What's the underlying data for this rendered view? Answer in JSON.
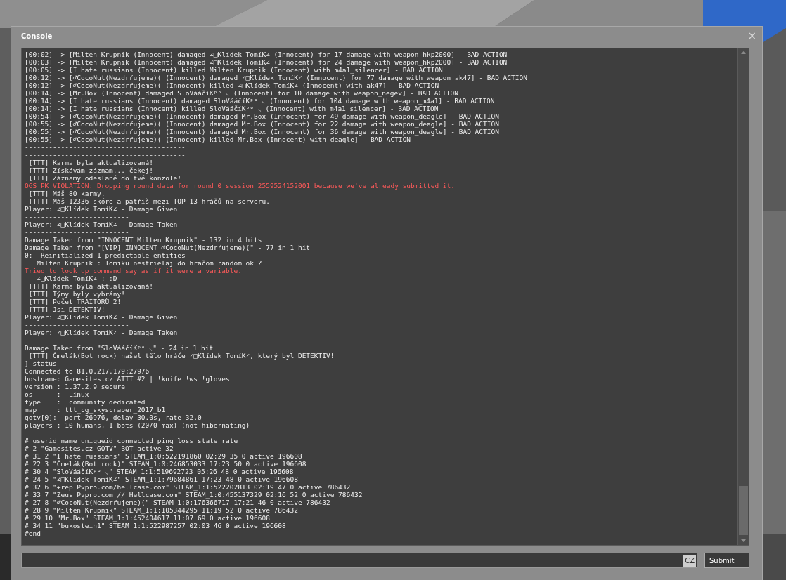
{
  "window": {
    "title": "Console",
    "close": "×"
  },
  "lines": [
    {
      "kind": "normal",
      "text": "[00:02] -> [Milten Krupnik (Innocent) damaged ∠□Klídek TomíK∠ (Innocent) for 17 damage with weapon_hkp2000] - BAD ACTION"
    },
    {
      "kind": "normal",
      "text": "[00:03] -> [Milten Krupnik (Innocent) damaged ∠□Klídek TomíK∠ (Innocent) for 24 damage with weapon_hkp2000] - BAD ACTION"
    },
    {
      "kind": "normal",
      "text": "[00:05] -> [I hate russians (Innocent) killed Milten Krupnik (Innocent) with m4a1_silencer] - BAD ACTION"
    },
    {
      "kind": "normal",
      "text": "[00:12] -> [♂CocoNut(Nezdrŕujeme)( (Innocent) damaged ∠□Klídek TomíK∠ (Innocent) for 77 damage with weapon_ak47] - BAD ACTION"
    },
    {
      "kind": "normal",
      "text": "[00:12] -> [♂CocoNut(Nezdrŕujeme)( (Innocent) killed ∠□Klídek TomíK∠ (Innocent) with ak47] - BAD ACTION"
    },
    {
      "kind": "normal",
      "text": "[00:14] -> [Mr.Box (Innocent) damaged SloVááčíKᵖᵒ ⸜ (Innocent) for 10 damage with weapon_negev] - BAD ACTION"
    },
    {
      "kind": "normal",
      "text": "[00:14] -> [I hate russians (Innocent) damaged SloVááčíKᵖᵒ ⸜ (Innocent) for 104 damage with weapon_m4a1] - BAD ACTION"
    },
    {
      "kind": "normal",
      "text": "[00:14] -> [I hate russians (Innocent) killed SloVááčíKᵖᵒ ⸜ (Innocent) with m4a1_silencer] - BAD ACTION"
    },
    {
      "kind": "normal",
      "text": "[00:54] -> [♂CocoNut(Nezdrŕujeme)( (Innocent) damaged Mr.Box (Innocent) for 49 damage with weapon_deagle] - BAD ACTION"
    },
    {
      "kind": "normal",
      "text": "[00:55] -> [♂CocoNut(Nezdrŕujeme)( (Innocent) damaged Mr.Box (Innocent) for 22 damage with weapon_deagle] - BAD ACTION"
    },
    {
      "kind": "normal",
      "text": "[00:55] -> [♂CocoNut(Nezdrŕujeme)( (Innocent) damaged Mr.Box (Innocent) for 36 damage with weapon_deagle] - BAD ACTION"
    },
    {
      "kind": "normal",
      "text": "[00:55] -> [♂CocoNut(Nezdrŕujeme)( (Innocent) killed Mr.Box (Innocent) with deagle] - BAD ACTION"
    },
    {
      "kind": "normal",
      "text": "----------------------------------------"
    },
    {
      "kind": "normal",
      "text": "----------------------------------------"
    },
    {
      "kind": "normal",
      "text": " [TTT] Karma byla aktualizovaná!"
    },
    {
      "kind": "normal",
      "text": " [TTT] Získávám záznam... čekej!"
    },
    {
      "kind": "normal",
      "text": " [TTT] Záznamy odeslané do tvé konzole!"
    },
    {
      "kind": "error",
      "text": "OGS PK VIOLATION: Dropping round data for round 0 session 2559524152001 because we've already submitted it."
    },
    {
      "kind": "normal",
      "text": " [TTT] Máš 80 karmy."
    },
    {
      "kind": "normal",
      "text": " [TTT] Máš 12336 skóre a patříš mezi TOP 13 hráčů na serveru."
    },
    {
      "kind": "normal",
      "text": "Player: ∠□Klídek TomíK∠ - Damage Given"
    },
    {
      "kind": "normal",
      "text": "--------------------------"
    },
    {
      "kind": "normal",
      "text": "Player: ∠□Klídek TomíK∠ - Damage Taken"
    },
    {
      "kind": "normal",
      "text": "--------------------------"
    },
    {
      "kind": "normal",
      "text": "Damage Taken from \"INNOCENT Milten Krupnik\" - 132 in 4 hits"
    },
    {
      "kind": "normal",
      "text": "Damage Taken from \"[VIP] INNOCENT ♂CocoNut(Nezdrŕujeme)(\" - 77 in 1 hit"
    },
    {
      "kind": "normal",
      "text": "0:  Reinitialized 1 predictable entities"
    },
    {
      "kind": "normal",
      "text": "   Milten Krupnik : Tomiku nestrielaj do hračom random ok ?"
    },
    {
      "kind": "error",
      "text": "Tried to look up command say as if it were a variable."
    },
    {
      "kind": "normal",
      "text": "   ∠□Klídek TomíK∠ : :D"
    },
    {
      "kind": "normal",
      "text": " [TTT] Karma byla aktualizovaná!"
    },
    {
      "kind": "normal",
      "text": " [TTT] Týmy byly vybrány!"
    },
    {
      "kind": "normal",
      "text": " [TTT] Počet TRAITORŮ 2!"
    },
    {
      "kind": "normal",
      "text": " [TTT] Jsi DETEKTIV!"
    },
    {
      "kind": "normal",
      "text": "Player: ∠□Klídek TomíK∠ - Damage Given"
    },
    {
      "kind": "normal",
      "text": "--------------------------"
    },
    {
      "kind": "normal",
      "text": "Player: ∠□Klídek TomíK∠ - Damage Taken"
    },
    {
      "kind": "normal",
      "text": "--------------------------"
    },
    {
      "kind": "normal",
      "text": "Damage Taken from \"SloVááčíKᵖᵒ ⸜\" - 24 in 1 hit"
    },
    {
      "kind": "normal",
      "text": " [TTT] Čmelák(Bot rock) našel tělo hráče ∠□Klídek TomíK∠, který byl DETEKTIV!"
    },
    {
      "kind": "normal",
      "text": "] status"
    },
    {
      "kind": "normal",
      "text": "Connected to 81.0.217.179:27976"
    },
    {
      "kind": "normal",
      "text": "hostname: Gamesites.cz ATTT #2 | !knife !ws !gloves"
    },
    {
      "kind": "normal",
      "text": "version : 1.37.2.9 secure"
    },
    {
      "kind": "normal",
      "text": "os      :  Linux"
    },
    {
      "kind": "normal",
      "text": "type    :  community dedicated"
    },
    {
      "kind": "normal",
      "text": "map     : ttt_cg_skyscraper_2017_b1"
    },
    {
      "kind": "normal",
      "text": "gotv[0]:  port 26976, delay 30.0s, rate 32.0"
    },
    {
      "kind": "normal",
      "text": "players : 10 humans, 1 bots (20/0 max) (not hibernating)"
    },
    {
      "kind": "blank"
    },
    {
      "kind": "normal",
      "text": "# userid name uniqueid connected ping loss state rate"
    },
    {
      "kind": "normal",
      "text": "# 2 \"Gamesites.cz GOTV\" BOT active 32"
    },
    {
      "kind": "normal",
      "text": "# 31 2 \"I hate russians\" STEAM_1:0:522191860 02:29 35 0 active 196608"
    },
    {
      "kind": "normal",
      "text": "# 22 3 \"Čmelák(Bot rock)\" STEAM_1:0:246853033 17:23 50 0 active 196608"
    },
    {
      "kind": "normal",
      "text": "# 30 4 \"SloVááčíKᵖᵒ ⸜\" STEAM_1:1:519692723 05:26 48 0 active 196608"
    },
    {
      "kind": "normal",
      "text": "# 24 5 \"∠□Klídek TomíK∠\" STEAM_1:1:79684861 17:23 48 0 active 196608"
    },
    {
      "kind": "normal",
      "text": "# 32 6 \"+rep Pvpro.com/hellcase.com\" STEAM_1:1:522202813 02:19 47 0 active 786432"
    },
    {
      "kind": "normal",
      "text": "# 33 7 \"Zeus Pvpro.com // Hellcase.com\" STEAM_1:0:455137329 02:16 52 0 active 786432"
    },
    {
      "kind": "normal",
      "text": "# 27 8 \"♂CocoNut(Nezdrŕujeme)(\" STEAM_1:0:176366717 17:21 46 0 active 786432"
    },
    {
      "kind": "normal",
      "text": "# 28 9 \"Milten Krupnik\" STEAM_1:1:105344295 11:19 52 0 active 786432"
    },
    {
      "kind": "normal",
      "text": "# 29 10 \"Mr.Box\" STEAM_1:1:452404617 11:07 69 0 active 196608"
    },
    {
      "kind": "normal",
      "text": "# 34 11 \"bukostein1\" STEAM_1:1:522987257 02:03 46 0 active 196608"
    },
    {
      "kind": "normal",
      "text": "#end"
    }
  ],
  "input": {
    "language": "CZ"
  },
  "buttons": [
    "Submit"
  ]
}
